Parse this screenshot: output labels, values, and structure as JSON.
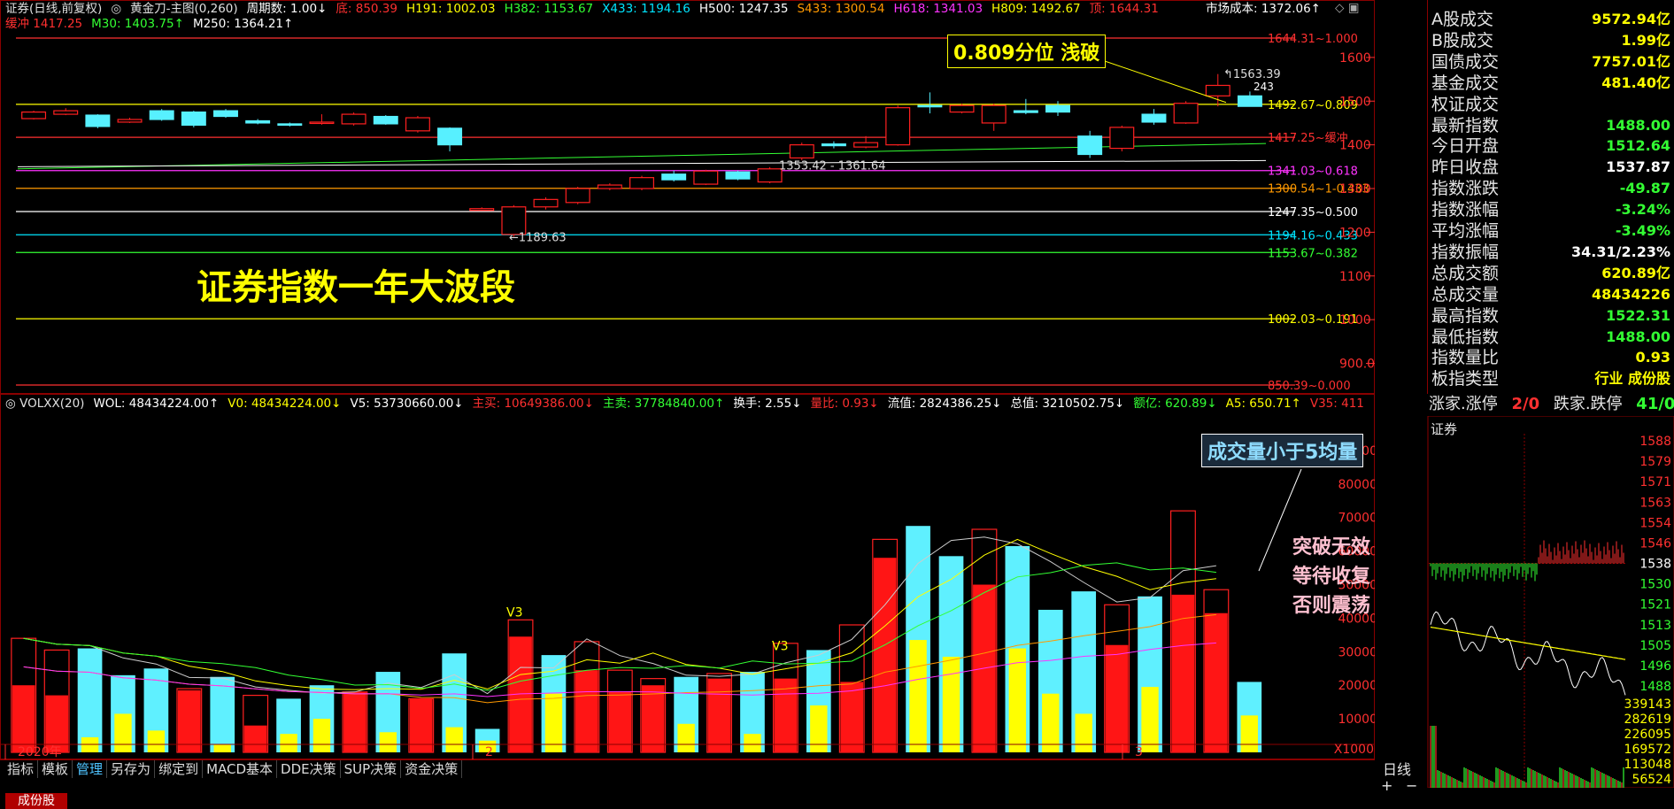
{
  "header": {
    "segments": [
      {
        "text": "证券(日线,前复权)",
        "color": "#e0e0e0"
      },
      {
        "text": "◎",
        "color": "#cccccc"
      },
      {
        "text": "黄金刀-主图(0,260)",
        "color": "#e0e0e0"
      },
      {
        "text": "周期数: 1.00↓",
        "color": "#ffffff"
      },
      {
        "text": "底: 850.39",
        "color": "#ff3030"
      },
      {
        "text": "H191: 1002.03",
        "color": "#ffff00"
      },
      {
        "text": "H382: 1153.67",
        "color": "#33ff33"
      },
      {
        "text": "X433: 1194.16",
        "color": "#00e5ff"
      },
      {
        "text": "H500: 1247.35",
        "color": "#ffffff"
      },
      {
        "text": "S433: 1300.54",
        "color": "#ff9900"
      },
      {
        "text": "H618: 1341.03",
        "color": "#ff33ff"
      },
      {
        "text": "H809: 1492.67",
        "color": "#ffff00"
      },
      {
        "text": "顶: 1644.31",
        "color": "#ff3030"
      }
    ],
    "cost": "市场成本: 1372.06↑",
    "row2": [
      {
        "text": "缓冲 1417.25",
        "color": "#ff3030"
      },
      {
        "text": "M30: 1403.75↑",
        "color": "#33ff33"
      },
      {
        "text": "M250: 1364.21↑",
        "color": "#ffffff"
      }
    ]
  },
  "annotations": {
    "title": "证券指数一年大波段",
    "box1": "0.809分位 浅破",
    "box2": "成交量小于5均量",
    "notes": [
      "突破无效",
      "等待收复",
      "否则震荡"
    ]
  },
  "chart_data": [
    {
      "type": "candlestick",
      "title": "证券(日线,前复权)",
      "y_ticks": [
        900.0,
        1000,
        1100,
        1200,
        1300,
        1400,
        1500,
        1600
      ],
      "ylim": [
        850.39,
        1644.31
      ],
      "levels": [
        {
          "label": "1644.31~1.000",
          "value": 1644.31,
          "color": "#ff3030"
        },
        {
          "label": "1492.67~0.809",
          "value": 1492.67,
          "color": "#ffff00"
        },
        {
          "label": "1417.25~缓冲",
          "value": 1417.25,
          "color": "#ff3030"
        },
        {
          "label": "1341.03~0.618",
          "value": 1341.03,
          "color": "#ff33ff"
        },
        {
          "label": "1300.54~1-0.433",
          "value": 1300.54,
          "color": "#ff9900"
        },
        {
          "label": "1247.35~0.500",
          "value": 1247.35,
          "color": "#ffffff"
        },
        {
          "label": "1194.16~0.433",
          "value": 1194.16,
          "color": "#00e5ff"
        },
        {
          "label": "1153.67~0.382",
          "value": 1153.67,
          "color": "#33ff33"
        },
        {
          "label": "1002.03~0.191",
          "value": 1002.03,
          "color": "#ffff00"
        },
        {
          "label": "850.39~0.000",
          "value": 850.39,
          "color": "#ff3030"
        }
      ],
      "labels": {
        "low": "1189.63",
        "high": "1563.39",
        "range": "1353.42 - 1361.64",
        "tiny": "243"
      },
      "candles": [
        {
          "o": 1460,
          "c": 1475,
          "h": 1478,
          "l": 1458
        },
        {
          "o": 1470,
          "c": 1478,
          "h": 1484,
          "l": 1468
        },
        {
          "o": 1468,
          "c": 1442,
          "h": 1470,
          "l": 1438
        },
        {
          "o": 1452,
          "c": 1458,
          "h": 1462,
          "l": 1450
        },
        {
          "o": 1478,
          "c": 1458,
          "h": 1482,
          "l": 1455
        },
        {
          "o": 1475,
          "c": 1445,
          "h": 1478,
          "l": 1440
        },
        {
          "o": 1478,
          "c": 1465,
          "h": 1482,
          "l": 1462
        },
        {
          "o": 1455,
          "c": 1450,
          "h": 1459,
          "l": 1447
        },
        {
          "o": 1448,
          "c": 1445,
          "h": 1451,
          "l": 1442
        },
        {
          "o": 1450,
          "c": 1452,
          "h": 1470,
          "l": 1446
        },
        {
          "o": 1448,
          "c": 1470,
          "h": 1474,
          "l": 1444
        },
        {
          "o": 1465,
          "c": 1448,
          "h": 1468,
          "l": 1446
        },
        {
          "o": 1432,
          "c": 1462,
          "h": 1466,
          "l": 1428
        },
        {
          "o": 1438,
          "c": 1400,
          "h": 1440,
          "l": 1385
        },
        {
          "o": 1250,
          "c": 1254,
          "h": 1257,
          "l": 1249
        },
        {
          "o": 1195,
          "c": 1258,
          "h": 1262,
          "l": 1190
        },
        {
          "o": 1258,
          "c": 1275,
          "h": 1280,
          "l": 1252
        },
        {
          "o": 1268,
          "c": 1300,
          "h": 1304,
          "l": 1264
        },
        {
          "o": 1300,
          "c": 1308,
          "h": 1312,
          "l": 1296
        },
        {
          "o": 1300,
          "c": 1325,
          "h": 1329,
          "l": 1296
        },
        {
          "o": 1333,
          "c": 1320,
          "h": 1341,
          "l": 1316
        },
        {
          "o": 1310,
          "c": 1340,
          "h": 1343,
          "l": 1308
        },
        {
          "o": 1338,
          "c": 1322,
          "h": 1341,
          "l": 1319
        },
        {
          "o": 1315,
          "c": 1345,
          "h": 1349,
          "l": 1312
        },
        {
          "o": 1370,
          "c": 1400,
          "h": 1405,
          "l": 1365
        },
        {
          "o": 1402,
          "c": 1398,
          "h": 1408,
          "l": 1392
        },
        {
          "o": 1395,
          "c": 1405,
          "h": 1420,
          "l": 1392
        },
        {
          "o": 1400,
          "c": 1485,
          "h": 1490,
          "l": 1398
        },
        {
          "o": 1490,
          "c": 1488,
          "h": 1520,
          "l": 1472
        },
        {
          "o": 1475,
          "c": 1490,
          "h": 1494,
          "l": 1472
        },
        {
          "o": 1450,
          "c": 1490,
          "h": 1494,
          "l": 1432
        },
        {
          "o": 1478,
          "c": 1474,
          "h": 1505,
          "l": 1470
        },
        {
          "o": 1490,
          "c": 1475,
          "h": 1500,
          "l": 1466
        },
        {
          "o": 1420,
          "c": 1378,
          "h": 1432,
          "l": 1370
        },
        {
          "o": 1392,
          "c": 1440,
          "h": 1444,
          "l": 1385
        },
        {
          "o": 1470,
          "c": 1452,
          "h": 1482,
          "l": 1446
        },
        {
          "o": 1450,
          "c": 1495,
          "h": 1500,
          "l": 1448
        },
        {
          "o": 1512,
          "c": 1536,
          "h": 1562,
          "l": 1488
        },
        {
          "o": 1512,
          "c": 1488,
          "h": 1522,
          "l": 1488
        }
      ],
      "ma_lines": [
        {
          "name": "M30",
          "color": "#33ff33",
          "start": 1345,
          "end": 1403
        },
        {
          "name": "M250",
          "color": "#ffffff",
          "start": 1350,
          "end": 1364
        }
      ]
    },
    {
      "type": "bar",
      "title": "VOLXX(20)",
      "y_ticks": [
        10000,
        20000,
        30000,
        40000,
        50000,
        60000,
        70000,
        80000,
        90000
      ],
      "ylim": [
        0,
        95000
      ],
      "x_labels": [
        "2020年",
        "2",
        "3"
      ],
      "unit": "X1000",
      "vol": [
        34000,
        30500,
        31000,
        23000,
        25000,
        19000,
        22500,
        17000,
        16000,
        20000,
        18000,
        24000,
        16000,
        29500,
        7000,
        39500,
        29000,
        33000,
        24500,
        22000,
        22500,
        23500,
        24000,
        32500,
        30500,
        38000,
        63500,
        67500,
        58500,
        66500,
        61500,
        42500,
        48000,
        44000,
        46500,
        72000,
        48500
      ],
      "small": [
        20000,
        17000,
        4500,
        11500,
        6500,
        18500,
        2500,
        8000,
        5500,
        10000,
        18000,
        6000,
        16000,
        7500,
        3500,
        34500,
        17500,
        24500,
        18000,
        20000,
        8500,
        22000,
        5500,
        22000,
        14000,
        21000,
        58000,
        33500,
        28500,
        50000,
        31000,
        17500,
        11500,
        32000,
        19500,
        47000,
        41500,
        11000
      ],
      "dir": [
        "r",
        "r",
        "c",
        "c",
        "c",
        "r",
        "c",
        "r",
        "c",
        "c",
        "r",
        "c",
        "r",
        "c",
        "c",
        "r",
        "c",
        "r",
        "r",
        "r",
        "c",
        "r",
        "c",
        "r",
        "c",
        "r",
        "r",
        "c",
        "c",
        "r",
        "c",
        "c",
        "c",
        "r",
        "c",
        "r",
        "r",
        "c"
      ],
      "labels": {
        "v3a": "V3",
        "v3b": "V3"
      }
    },
    {
      "type": "line",
      "title": "证券",
      "y_ticks": [
        1588,
        1579,
        1571,
        1563,
        1554,
        1546,
        1538,
        1530,
        1521,
        1513,
        1505,
        1496,
        1488
      ],
      "vol_ticks": [
        339143,
        282619,
        226095,
        169572,
        113048,
        56524
      ]
    }
  ],
  "vol_header": [
    {
      "text": "◎ VOLXX(20)",
      "color": "#e0e0e0"
    },
    {
      "text": "WOL: 48434224.00↑",
      "color": "#ffffff"
    },
    {
      "text": "V0: 48434224.00↓",
      "color": "#ffff00"
    },
    {
      "text": "V5: 53730660.00↓",
      "color": "#ffffff"
    },
    {
      "text": "主买: 10649386.00↓",
      "color": "#ff3030"
    },
    {
      "text": "主卖: 37784840.00↑",
      "color": "#33ff33"
    },
    {
      "text": "换手: 2.55↓",
      "color": "#ffffff"
    },
    {
      "text": "量比: 0.93↓",
      "color": "#ff3030"
    },
    {
      "text": "流值: 2824386.25↓",
      "color": "#ffffff"
    },
    {
      "text": "总值: 3210502.75↓",
      "color": "#ffffff"
    },
    {
      "text": "额亿: 620.89↓",
      "color": "#33ff33"
    },
    {
      "text": "A5: 650.71↑",
      "color": "#ffff00"
    },
    {
      "text": "V35: 411",
      "color": "#ff3030"
    }
  ],
  "right_stats": [
    {
      "label": "A股成交",
      "value": "9572.94亿",
      "color": "#ffff00"
    },
    {
      "label": "B股成交",
      "value": "1.99亿",
      "color": "#ffff00"
    },
    {
      "label": "国债成交",
      "value": "7757.01亿",
      "color": "#ffff00"
    },
    {
      "label": "基金成交",
      "value": "481.40亿",
      "color": "#ffff00"
    },
    {
      "label": "权证成交",
      "value": "",
      "color": "#ffff00"
    },
    {
      "label": "最新指数",
      "value": "1488.00",
      "color": "#33ff33"
    },
    {
      "label": "今日开盘",
      "value": "1512.64",
      "color": "#33ff33"
    },
    {
      "label": "昨日收盘",
      "value": "1537.87",
      "color": "#ffffff"
    },
    {
      "label": "指数涨跌",
      "value": "-49.87",
      "color": "#33ff33"
    },
    {
      "label": "指数涨幅",
      "value": "-3.24%",
      "color": "#33ff33"
    },
    {
      "label": "平均涨幅",
      "value": "-3.49%",
      "color": "#33ff33"
    },
    {
      "label": "指数振幅",
      "value": "34.31/2.23%",
      "color": "#ffffff"
    },
    {
      "label": "总成交额",
      "value": "620.89亿",
      "color": "#ffff00"
    },
    {
      "label": "总成交量",
      "value": "48434226",
      "color": "#ffff00"
    },
    {
      "label": "最高指数",
      "value": "1522.31",
      "color": "#33ff33"
    },
    {
      "label": "最低指数",
      "value": "1488.00",
      "color": "#33ff33"
    },
    {
      "label": "指数量比",
      "value": "0.93",
      "color": "#ffff00"
    },
    {
      "label": "板指类型",
      "value": "行业 成份股",
      "color": "#ffff00"
    }
  ],
  "limit_row": {
    "a": "涨家.涨停",
    "b": "2/0",
    "c": "跌家.跌停",
    "d": "41/0"
  },
  "mini_title": "证券",
  "toolbar": {
    "items": [
      "指标",
      "模板",
      "管理",
      "另存为",
      "绑定到",
      "MACD基本",
      "DDE决策",
      "SUP决策",
      "资金决策"
    ],
    "active": "管理",
    "period": "日线",
    "plus": "+",
    "minus": "−"
  },
  "bottom_tab": "成份股",
  "colors": {
    "up": "#ff2020",
    "down": "#57f0ff",
    "yellow": "#ffff00"
  }
}
